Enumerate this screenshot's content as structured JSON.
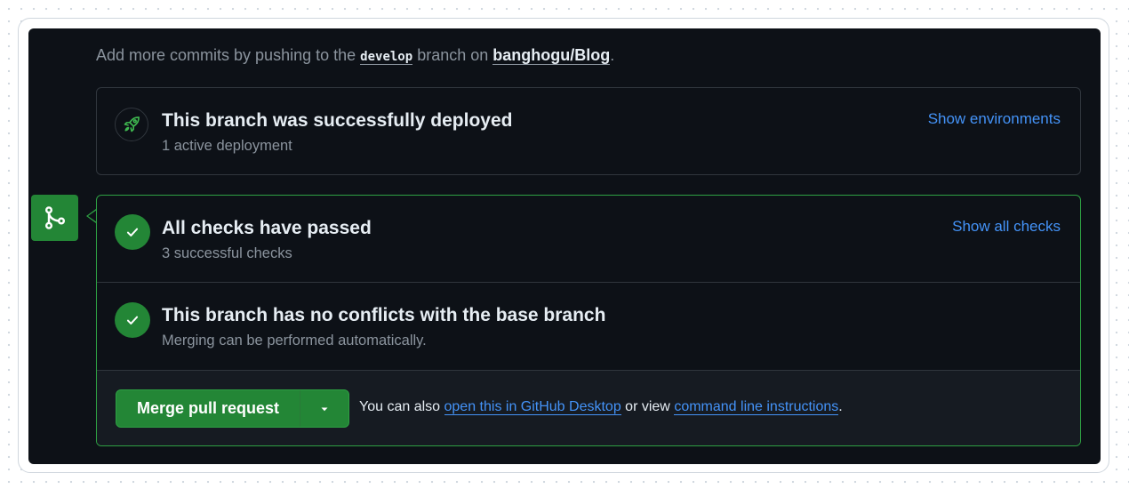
{
  "hint": {
    "prefix": "Add more commits by pushing to the",
    "branch": "develop",
    "middle": "branch on",
    "repo": "banghogu/Blog",
    "suffix": "."
  },
  "deployment": {
    "title": "This branch was successfully deployed",
    "subtitle": "1 active deployment",
    "link": "Show environments",
    "icon": "rocket-icon"
  },
  "checks": {
    "title": "All checks have passed",
    "subtitle": "3 successful checks",
    "link": "Show all checks",
    "icon": "check-icon"
  },
  "conflicts": {
    "title": "This branch has no conflicts with the base branch",
    "subtitle": "Merging can be performed automatically.",
    "icon": "check-icon"
  },
  "merge": {
    "button_label": "Merge pull request",
    "caret_icon": "triangle-down-icon",
    "side_icon": "git-merge-icon",
    "also_prefix": "You can also",
    "desktop_link": "open this in GitHub Desktop",
    "or_view": "or view",
    "cli_link": "command line instructions",
    "suffix": "."
  },
  "colors": {
    "accent_green": "#238636",
    "link_blue": "#4493f8",
    "background": "#0d1117"
  }
}
